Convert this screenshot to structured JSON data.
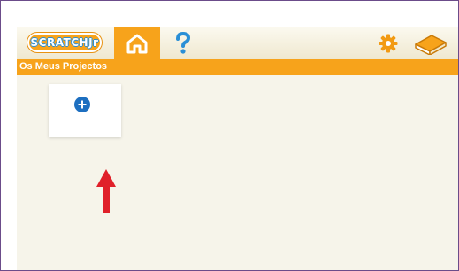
{
  "app": {
    "logo_text": "SCRATCHJr",
    "section_title": "Os Meus Projectos"
  },
  "icons": {
    "home": "home-icon",
    "help": "question-mark-icon",
    "settings": "gear-icon",
    "book": "book-icon",
    "new_project": "plus-circle-icon",
    "annotation": "red-arrow-up-icon"
  },
  "colors": {
    "accent_orange": "#f7a31b",
    "plus_blue": "#1d6fc0",
    "help_blue": "#2a8fd6",
    "annotation_red": "#e0202a",
    "background": "#f6f4ea"
  }
}
